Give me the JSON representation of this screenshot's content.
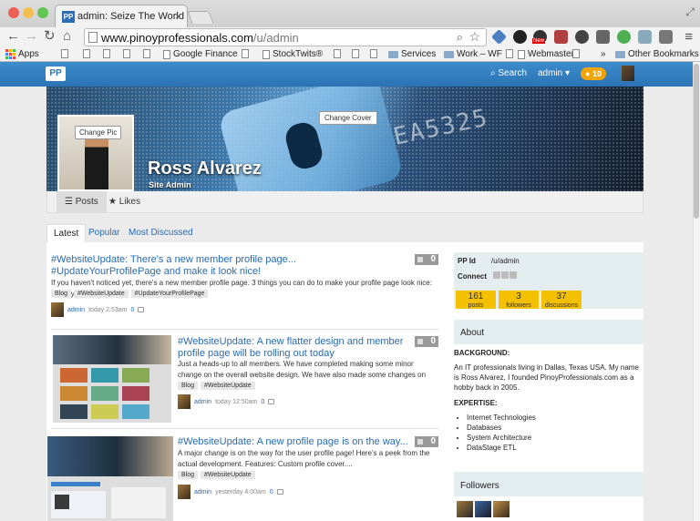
{
  "browser": {
    "tab_title": "admin: Seize The World | p",
    "tab_favicon": "PP",
    "url_host": "www.pinoyprofessionals.com",
    "url_path": "/u/admin",
    "bookmarks": [
      "Apps",
      "Google Finance",
      "StockTwits®",
      "Services",
      "Work – WF",
      "Webmaster",
      "Other Bookmarks"
    ],
    "bookmarks_overflow": "»",
    "extension_badge": "New",
    "colors": {
      "close": "#ec5f55",
      "minimize": "#f4be4f",
      "maximize": "#5fc654"
    }
  },
  "site": {
    "logo": "PP",
    "search_label": "Search",
    "admin_label": "admin",
    "notification_count": "10",
    "accent": "#2b73b4"
  },
  "profile": {
    "name": "Ross Alvarez",
    "role": "Site Admin",
    "change_cover": "Change Cover",
    "change_pic": "Change Pic",
    "tabs": [
      "Posts",
      "Likes"
    ],
    "cover_numbers": "EA5325"
  },
  "feed": {
    "tabs": [
      "Latest",
      "Popular",
      "Most Discussed"
    ],
    "posts": [
      {
        "title": "#WebsiteUpdate: There's a new member profile page... #UpdateYourProfilePage and make it look nice!",
        "excerpt": "If you haven't noticed yet, there's a new member profile page. 3 things you can do to make your profile page look nice: Go to your....",
        "tags": [
          "Blog",
          "#WebsiteUpdate",
          "#UpdateYourProfilePage"
        ],
        "author": "admin",
        "time": "today 2:53am",
        "comments": "0",
        "likes": "0"
      },
      {
        "title": "#WebsiteUpdate: A new flatter design and member profile page will be rolling out today",
        "excerpt": "Just a heads-up to all members. We have completed making some minor change on the overall website design. We have also made some changes on the....",
        "tags": [
          "Blog",
          "#WebsiteUpdate"
        ],
        "author": "admin",
        "time": "today 12:50am",
        "comments": "0",
        "likes": "0"
      },
      {
        "title": "#WebsiteUpdate: A new profile page is on the way...",
        "excerpt": "A major change is on the way for the user profile page! Here's a peek from the actual development. Features: Custom profile cover....",
        "tags": [
          "Blog",
          "#WebsiteUpdate"
        ],
        "author": "admin",
        "time": "yesterday 4:00am",
        "comments": "0",
        "likes": "0"
      }
    ]
  },
  "sidebar": {
    "pp_id_label": "PP Id",
    "pp_id_value": "/u/admin",
    "connect_label": "Connect",
    "stats": [
      {
        "value": "161",
        "label": "posts"
      },
      {
        "value": "3",
        "label": "followers"
      },
      {
        "value": "37",
        "label": "discussions"
      }
    ],
    "about_title": "About",
    "background_heading": "BACKGROUND:",
    "background_text": "An IT professionals living in Dallas, Texas USA. My name is Ross Alvarez, I founded PinoyProfessionals.com as a hobby back in 2005.",
    "expertise_heading": "EXPERTISE:",
    "expertise": [
      "Internet Technologies",
      "Databases",
      "System Architecture",
      "DataStage ETL"
    ],
    "followers_title": "Followers"
  }
}
